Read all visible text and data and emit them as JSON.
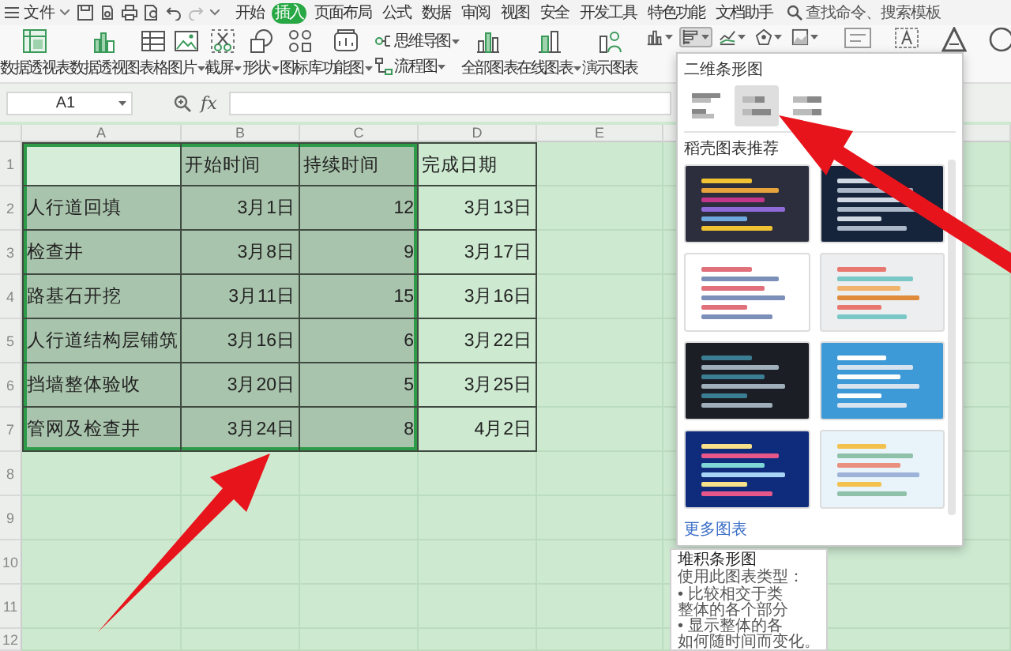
{
  "menu_bar": {
    "file_label": "文件",
    "tabs": [
      {
        "label": "开始",
        "selected": false
      },
      {
        "label": "插入",
        "selected": true
      },
      {
        "label": "页面布局",
        "selected": false
      },
      {
        "label": "公式",
        "selected": false
      },
      {
        "label": "数据",
        "selected": false
      },
      {
        "label": "审阅",
        "selected": false
      },
      {
        "label": "视图",
        "selected": false
      },
      {
        "label": "安全",
        "selected": false
      },
      {
        "label": "开发工具",
        "selected": false
      },
      {
        "label": "特色功能",
        "selected": false
      },
      {
        "label": "文档助手",
        "selected": false
      }
    ],
    "search": {
      "placeholder": "查找命令、搜索模板"
    }
  },
  "ribbon": {
    "items": [
      {
        "kind": "large",
        "label": "数据透视表",
        "dropdown": false
      },
      {
        "kind": "large",
        "label": "数据透视图",
        "dropdown": false
      },
      {
        "kind": "large",
        "label": "表格",
        "dropdown": false
      },
      {
        "kind": "large",
        "label": "图片",
        "dropdown": true
      },
      {
        "kind": "large",
        "label": "截屏",
        "dropdown": true
      },
      {
        "kind": "large",
        "label": "形状",
        "dropdown": true
      },
      {
        "kind": "large",
        "label": "图标库",
        "dropdown": false
      },
      {
        "kind": "large",
        "label": "功能图",
        "dropdown": true
      },
      {
        "kind": "stacked",
        "entries": [
          {
            "label": "思维导图",
            "dropdown": true
          },
          {
            "label": "流程图",
            "dropdown": true
          }
        ]
      },
      {
        "kind": "large",
        "label": "全部图表",
        "dropdown": false
      },
      {
        "kind": "large",
        "label": "在线图表",
        "dropdown": true
      },
      {
        "kind": "large",
        "label": "演示图表",
        "dropdown": false
      }
    ],
    "chart_buttons": [
      {
        "selected": false
      },
      {
        "selected": true
      },
      {
        "selected": false
      },
      {
        "selected": false
      },
      {
        "selected": false
      }
    ]
  },
  "formula_bar": {
    "cell_ref": "A1",
    "fx": "fx"
  },
  "sheet": {
    "columns": [
      {
        "label": "A",
        "kind": "text"
      },
      {
        "label": "B",
        "kind": "number"
      },
      {
        "label": "C",
        "kind": "number"
      },
      {
        "label": "D",
        "kind": "number"
      },
      {
        "label": "E"
      }
    ],
    "rows": [
      {
        "number": "1",
        "kind": "header",
        "cells": [
          {
            "selected": true,
            "active": true
          },
          {
            "text": "开始时间",
            "selected": true
          },
          {
            "text": "持续时间",
            "selected": true
          },
          {
            "text": "完成日期",
            "selected": false
          }
        ]
      },
      {
        "number": "2",
        "kind": "data",
        "cells": [
          {
            "text": "人行道回填",
            "selected": true
          },
          {
            "text": "3月1日",
            "selected": true
          },
          {
            "text": "12",
            "selected": true
          },
          {
            "text": "3月13日",
            "selected": false
          }
        ]
      },
      {
        "number": "3",
        "kind": "data",
        "cells": [
          {
            "text": "检查井",
            "selected": true
          },
          {
            "text": "3月8日",
            "selected": true
          },
          {
            "text": "9",
            "selected": true
          },
          {
            "text": "3月17日",
            "selected": false
          }
        ]
      },
      {
        "number": "4",
        "kind": "data",
        "cells": [
          {
            "text": "路基石开挖",
            "selected": true
          },
          {
            "text": "3月11日",
            "selected": true
          },
          {
            "text": "15",
            "selected": true
          },
          {
            "text": "3月16日",
            "selected": false
          }
        ]
      },
      {
        "number": "5",
        "kind": "data",
        "cells": [
          {
            "text": "人行道结构层铺筑",
            "selected": true
          },
          {
            "text": "3月16日",
            "selected": true
          },
          {
            "text": "6",
            "selected": true
          },
          {
            "text": "3月22日",
            "selected": false
          }
        ]
      },
      {
        "number": "6",
        "kind": "data",
        "cells": [
          {
            "text": "挡墙整体验收",
            "selected": true
          },
          {
            "text": "3月20日",
            "selected": true
          },
          {
            "text": "5",
            "selected": true
          },
          {
            "text": "3月25日",
            "selected": false
          }
        ]
      },
      {
        "number": "7",
        "kind": "data",
        "cells": [
          {
            "text": "管网及检查井",
            "selected": true
          },
          {
            "text": "3月24日",
            "selected": true
          },
          {
            "text": "8",
            "selected": true
          },
          {
            "text": "4月2日",
            "selected": false
          }
        ]
      }
    ],
    "empty_rows": [
      "8",
      "9",
      "10",
      "11",
      "12"
    ]
  },
  "chart_menu": {
    "section_title": "二维条形图",
    "types": [
      {
        "kind": "clustered",
        "selected": false
      },
      {
        "kind": "stacked",
        "selected": true
      },
      {
        "kind": "percent",
        "selected": false
      }
    ],
    "recommend_title": "稻壳图表推荐",
    "templates": [
      {
        "kind": "dark"
      },
      {
        "kind": "navy"
      },
      {
        "kind": "white"
      },
      {
        "kind": "photo"
      },
      {
        "kind": "black"
      },
      {
        "kind": "sky"
      },
      {
        "kind": "blue"
      },
      {
        "kind": "pastel"
      }
    ],
    "more_link": "更多图表"
  },
  "tooltip": {
    "title": "堆积条形图",
    "lines": [
      "使用此图表类型：",
      "• 比较相交于类",
      "整体的各个部分",
      "• 显示整体的各",
      "如何随时间而变化。"
    ]
  }
}
